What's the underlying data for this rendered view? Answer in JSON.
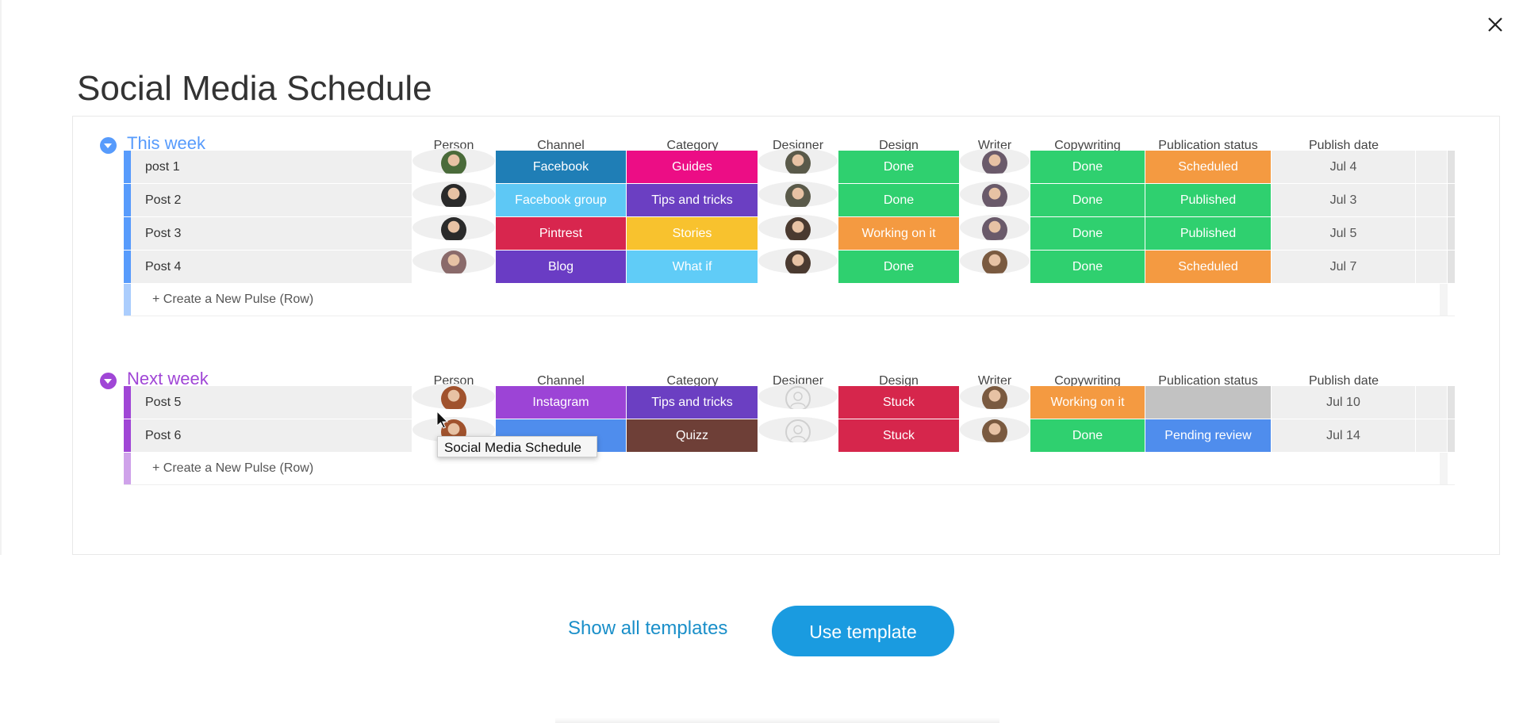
{
  "title": "Social Media Schedule",
  "close_icon": "close-icon",
  "columns": [
    "Person",
    "Channel",
    "Category",
    "Designer",
    "Design",
    "Writer",
    "Copywriting",
    "Publication status",
    "Publish date"
  ],
  "groups": [
    {
      "title": "This week",
      "color": "#579bfc",
      "create_label": "+ Create a New Pulse (Row)",
      "rows": [
        {
          "name": "post 1",
          "person": "avatar-man-green",
          "channel": {
            "label": "Facebook",
            "color": "#1f7eb6"
          },
          "category": {
            "label": "Guides",
            "color": "#ec0d85"
          },
          "designer": "avatar-woman-glasses",
          "design": {
            "label": "Done",
            "color": "#2fd06f"
          },
          "writer": "avatar-man-sunglasses",
          "copywriting": {
            "label": "Done",
            "color": "#2fd06f"
          },
          "publication_status": {
            "label": "Scheduled",
            "color": "#f49a41"
          },
          "publish_date": "Jul 4"
        },
        {
          "name": "Post 2",
          "person": "avatar-woman-dark",
          "channel": {
            "label": "Facebook group",
            "color": "#5ec8f5"
          },
          "category": {
            "label": "Tips and tricks",
            "color": "#6b3fc2"
          },
          "designer": "avatar-woman-glasses",
          "design": {
            "label": "Done",
            "color": "#2fd06f"
          },
          "writer": "avatar-man-sunglasses",
          "copywriting": {
            "label": "Done",
            "color": "#2fd06f"
          },
          "publication_status": {
            "label": "Published",
            "color": "#2fd06f"
          },
          "publish_date": "Jul 3"
        },
        {
          "name": "Post 3",
          "person": "avatar-woman-dark",
          "channel": {
            "label": "Pintrest",
            "color": "#d8264e"
          },
          "category": {
            "label": "Stories",
            "color": "#f8c22e"
          },
          "designer": "avatar-man-curly",
          "design": {
            "label": "Working on it",
            "color": "#f49a41"
          },
          "writer": "avatar-man-sunglasses",
          "copywriting": {
            "label": "Done",
            "color": "#2fd06f"
          },
          "publication_status": {
            "label": "Published",
            "color": "#2fd06f"
          },
          "publish_date": "Jul 5"
        },
        {
          "name": "Post 4",
          "person": "avatar-woman-longhair",
          "channel": {
            "label": "Blog",
            "color": "#6a3cc4"
          },
          "category": {
            "label": "What if",
            "color": "#60ccf7"
          },
          "designer": "avatar-man-curly",
          "design": {
            "label": "Done",
            "color": "#2fd06f"
          },
          "writer": "avatar-man-smiling",
          "copywriting": {
            "label": "Done",
            "color": "#2fd06f"
          },
          "publication_status": {
            "label": "Scheduled",
            "color": "#f49a41"
          },
          "publish_date": "Jul 7"
        }
      ]
    },
    {
      "title": "Next week",
      "color": "#a046d6",
      "create_label": "+ Create a New Pulse (Row)",
      "rows": [
        {
          "name": "Post 5",
          "person": "avatar-woman-red",
          "channel": {
            "label": "Instagram",
            "color": "#9c44d6"
          },
          "category": {
            "label": "Tips and tricks",
            "color": "#6b3fc2"
          },
          "designer": "avatar-empty",
          "design": {
            "label": "Stuck",
            "color": "#d6264c"
          },
          "writer": "avatar-man-smiling",
          "copywriting": {
            "label": "Working on it",
            "color": "#f49a41"
          },
          "publication_status": {
            "label": "",
            "color": "#c2c2c2"
          },
          "publish_date": "Jul 10"
        },
        {
          "name": "Post 6",
          "person": "avatar-woman-red",
          "channel": {
            "label": "",
            "color": "#4f8ded"
          },
          "category": {
            "label": "Quizz",
            "color": "#6e3f37"
          },
          "designer": "avatar-empty",
          "design": {
            "label": "Stuck",
            "color": "#d6264c"
          },
          "writer": "avatar-man-smiling",
          "copywriting": {
            "label": "Done",
            "color": "#2fd06f"
          },
          "publication_status": {
            "label": "Pending review",
            "color": "#4f8ded"
          },
          "publish_date": "Jul 14"
        }
      ]
    }
  ],
  "tooltip": "Social Media Schedule",
  "footer": {
    "show_all_label": "Show all templates",
    "use_template_label": "Use template"
  },
  "avatar_colors": {
    "avatar-man-green": "#4a6b3a",
    "avatar-woman-dark": "#2a2a2a",
    "avatar-woman-glasses": "#5a5a4a",
    "avatar-man-curly": "#4a3a30",
    "avatar-man-sunglasses": "#6a5a6a",
    "avatar-man-smiling": "#7a5a40",
    "avatar-woman-longhair": "#8a6a6a",
    "avatar-woman-red": "#a0522d"
  }
}
